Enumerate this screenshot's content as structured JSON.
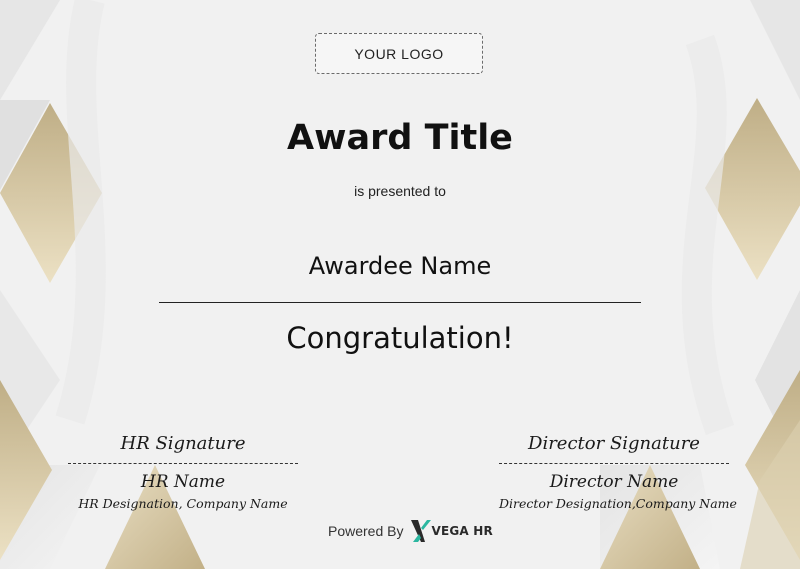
{
  "logo": {
    "text": "YOUR LOGO"
  },
  "award": {
    "title": "Award Title",
    "presented_to": "is presented to",
    "awardee": "Awardee Name",
    "congrats": "Congratulation!"
  },
  "signatures": {
    "hr": {
      "label": "HR Signature",
      "name": "HR Name",
      "designation": "HR Designation, Company Name"
    },
    "director": {
      "label": "Director Signature",
      "name": "Director Name",
      "designation": "Director Designation,Company Name"
    }
  },
  "footer": {
    "powered_by": "Powered By",
    "brand": "VEGA HR"
  },
  "colors": {
    "background": "#f1f1f1",
    "gold": "#cbb98d",
    "gold_light": "#e8dcbb",
    "text": "#111111",
    "brand_green": "#2bb7a0"
  }
}
